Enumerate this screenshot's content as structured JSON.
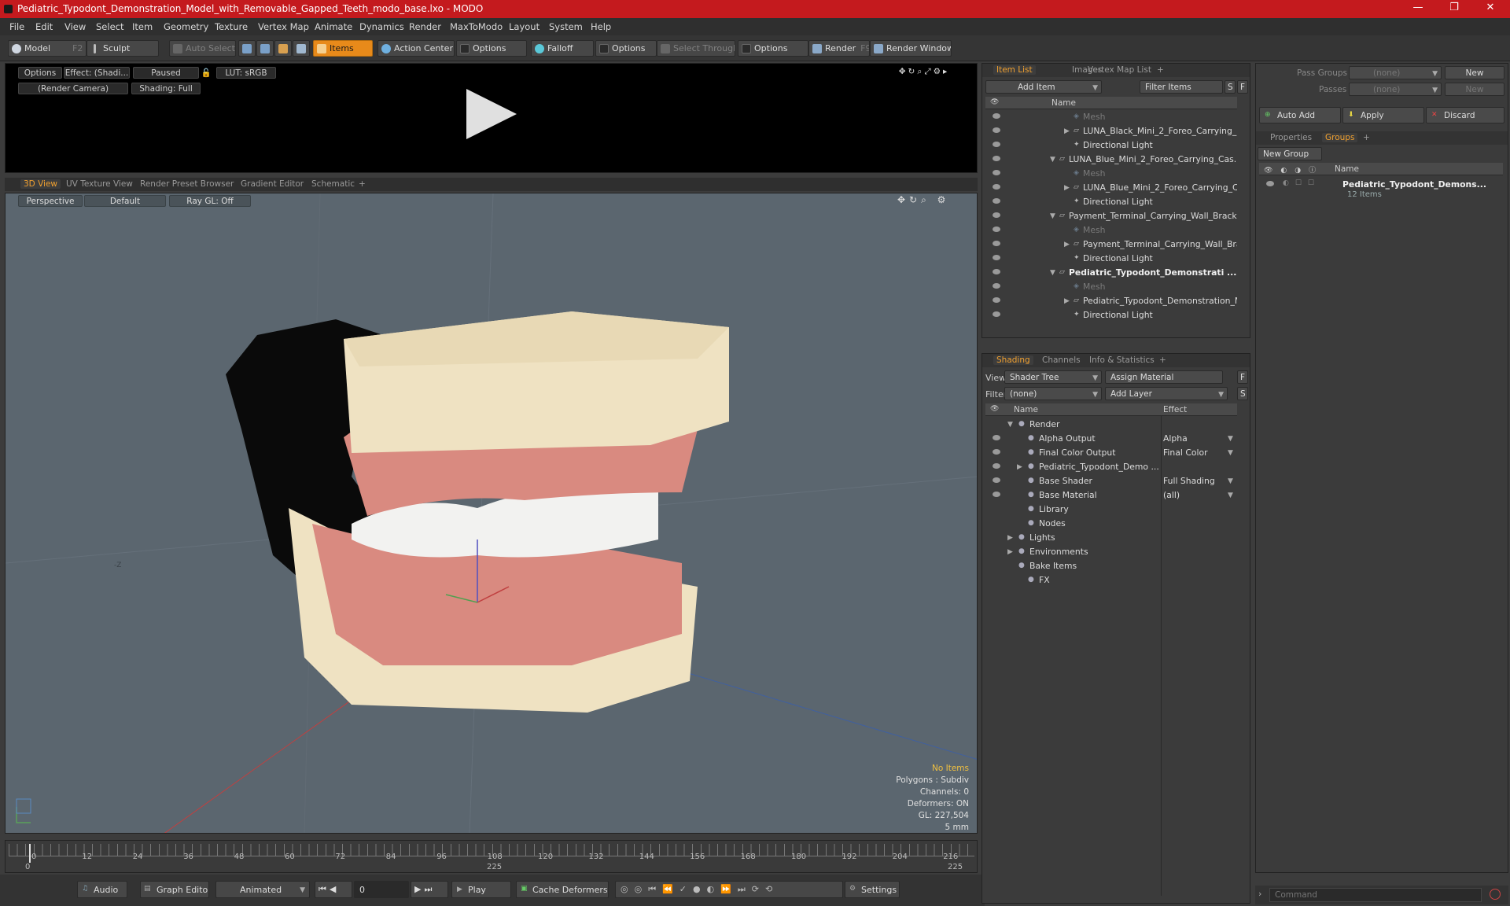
{
  "title": "Pediatric_Typodont_Demonstration_Model_with_Removable_Gapped_Teeth_modo_base.lxo - MODO",
  "menu": [
    "File",
    "Edit",
    "View",
    "Select",
    "Item",
    "Geometry",
    "Texture",
    "Vertex Map",
    "Animate",
    "Dynamics",
    "Render",
    "MaxToModo",
    "Layout",
    "System",
    "Help"
  ],
  "toolbar": {
    "model": "Model",
    "model_key": "F2",
    "sculpt": "Sculpt",
    "auto_select": "Auto Select",
    "items": "Items",
    "action_center": "Action Center",
    "options": "Options",
    "falloff": "Falloff",
    "select_through": "Select Through",
    "render": "Render",
    "render_key": "F9",
    "render_window": "Render Window"
  },
  "preview": {
    "options": "Options",
    "effect": "Effect: (Shadi...",
    "paused": "Paused",
    "lut": "LUT: sRGB",
    "camera": "(Render Camera)",
    "shading": "Shading: Full"
  },
  "view_tabs": [
    "3D View",
    "UV Texture View",
    "Render Preset Browser",
    "Gradient Editor",
    "Schematic",
    "+"
  ],
  "viewport": {
    "perspective": "Perspective",
    "default": "Default",
    "raygl": "Ray GL: Off",
    "no_items": "No Items",
    "polygons": "Polygons : Subdiv",
    "channels": "Channels: 0",
    "deformers": "Deformers: ON",
    "gl": "GL: 227,504",
    "scale": "5 mm",
    "axis_label": "-Z"
  },
  "timeline": {
    "ticks": [
      "0",
      "12",
      "24",
      "36",
      "48",
      "60",
      "72",
      "84",
      "96",
      "108",
      "120",
      "132",
      "144",
      "156",
      "168",
      "180",
      "192",
      "204",
      "216"
    ],
    "start": "0",
    "mid": "225",
    "end": "225"
  },
  "bottom": {
    "audio": "Audio",
    "graph_editor": "Graph Editor",
    "animated": "Animated",
    "frame": "0",
    "play": "Play",
    "cache": "Cache Deformers",
    "settings": "Settings"
  },
  "itemlist": {
    "tabs": [
      "Item List",
      "Images",
      "Vertex Map List",
      "+"
    ],
    "add_item": "Add Item",
    "filter": "Filter Items",
    "filter_s": "S",
    "filter_f": "F",
    "col_name": "Name",
    "rows": [
      {
        "t": "Mesh",
        "ind": 2,
        "dim": true
      },
      {
        "t": "LUNA_Black_Mini_2_Foreo_Carrying_...",
        "ind": 2,
        "exp": "▶"
      },
      {
        "t": "Directional Light",
        "ind": 2
      },
      {
        "t": "LUNA_Blue_Mini_2_Foreo_Carrying_Cas...",
        "ind": 1,
        "exp": "▼"
      },
      {
        "t": "Mesh",
        "ind": 2,
        "dim": true
      },
      {
        "t": "LUNA_Blue_Mini_2_Foreo_Carrying_C...",
        "ind": 2,
        "exp": "▶"
      },
      {
        "t": "Directional Light",
        "ind": 2
      },
      {
        "t": "Payment_Terminal_Carrying_Wall_Brack ...",
        "ind": 1,
        "exp": "▼"
      },
      {
        "t": "Mesh",
        "ind": 2,
        "dim": true
      },
      {
        "t": "Payment_Terminal_Carrying_Wall_Bra...",
        "ind": 2,
        "exp": "▶"
      },
      {
        "t": "Directional Light",
        "ind": 2
      },
      {
        "t": "Pediatric_Typodont_Demonstrati ...",
        "ind": 1,
        "exp": "▼",
        "bold": true
      },
      {
        "t": "Mesh",
        "ind": 2,
        "dim": true
      },
      {
        "t": "Pediatric_Typodont_Demonstration_M...",
        "ind": 2,
        "exp": "▶"
      },
      {
        "t": "Directional Light",
        "ind": 2
      }
    ]
  },
  "shading": {
    "tabs": [
      "Shading",
      "Channels",
      "Info & Statistics",
      "+"
    ],
    "view_label": "View",
    "view_value": "Shader Tree",
    "assign": "Assign Material",
    "filter_label": "Filter",
    "filter_value": "(none)",
    "add_layer": "Add Layer",
    "col_name": "Name",
    "col_effect": "Effect",
    "rows": [
      {
        "t": "Render",
        "e": "",
        "ind": 0,
        "exp": "▼",
        "eye": false
      },
      {
        "t": "Alpha Output",
        "e": "Alpha",
        "ind": 1,
        "eye": true
      },
      {
        "t": "Final Color Output",
        "e": "Final Color",
        "ind": 1,
        "eye": true
      },
      {
        "t": "Pediatric_Typodont_Demo ...",
        "e": "",
        "ind": 1,
        "exp": "▶",
        "eye": true
      },
      {
        "t": "Base Shader",
        "e": "Full Shading",
        "ind": 1,
        "eye": true
      },
      {
        "t": "Base Material",
        "e": "(all)",
        "ind": 1,
        "eye": true
      },
      {
        "t": "Library",
        "e": "",
        "ind": 1,
        "eye": false
      },
      {
        "t": "Nodes",
        "e": "",
        "ind": 1,
        "eye": false
      },
      {
        "t": "Lights",
        "e": "",
        "ind": 0,
        "exp": "▶",
        "eye": false
      },
      {
        "t": "Environments",
        "e": "",
        "ind": 0,
        "exp": "▶",
        "eye": false
      },
      {
        "t": "Bake Items",
        "e": "",
        "ind": 0,
        "eye": false
      },
      {
        "t": "FX",
        "e": "",
        "ind": 1,
        "eye": false
      }
    ]
  },
  "groups": {
    "pass_groups": "Pass Groups",
    "passes": "Passes",
    "none": "(none)",
    "new": "New",
    "auto_add": "Auto Add",
    "apply": "Apply",
    "discard": "Discard",
    "tabs": [
      "Properties",
      "Groups",
      "+"
    ],
    "new_group": "New Group",
    "col_name": "Name",
    "group_name": "Pediatric_Typodont_Demons...",
    "group_count": "12 Items"
  },
  "command": {
    "placeholder": "Command"
  }
}
